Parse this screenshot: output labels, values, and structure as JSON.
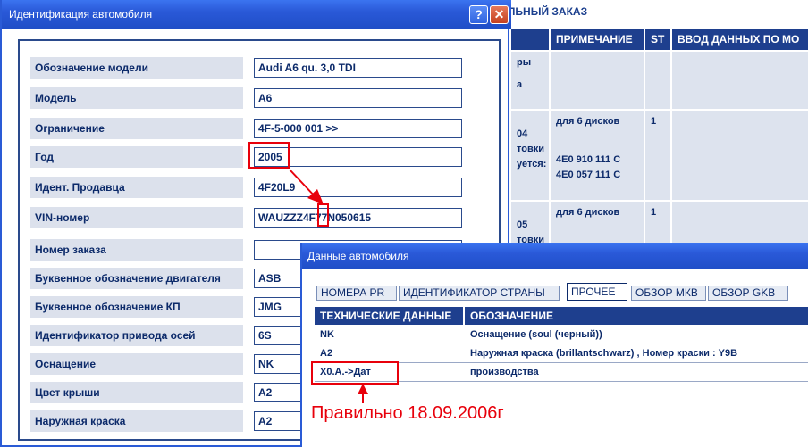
{
  "background": {
    "title": "ЛЬНЫЙ ЗАКАЗ",
    "headers": [
      "ПРИМЕЧАНИЕ",
      "ST",
      "ВВОД ДАННЫХ ПО МО"
    ],
    "left_fragments": {
      "r1": [
        "ры",
        "а"
      ],
      "r2": [
        "04",
        "товки",
        "уется:"
      ],
      "r3": [
        "05",
        "товки"
      ]
    },
    "rows": [
      {
        "note": "для 6 дисков",
        "st": "1",
        "parts": [
          "4E0 910 111 C",
          "4E0 057 111 C"
        ]
      },
      {
        "note": "для 6 дисков",
        "st": "1"
      }
    ]
  },
  "identification": {
    "title": "Идентификация автомобиля",
    "help_label": "?",
    "close_label": "✕",
    "fields": [
      {
        "label": "Обозначение модели",
        "value": "Audi A6 qu. 3,0 TDI"
      },
      {
        "label": "Модель",
        "value": "A6"
      },
      {
        "label": "Ограничение",
        "value": "4F-5-000 001 >>"
      },
      {
        "label": "Год",
        "value": "2005"
      },
      {
        "label": "Идент. Продавца",
        "value": "4F20L9"
      },
      {
        "label": "VIN-номер",
        "value": "WAUZZZ4F77N050615"
      },
      {
        "label": "Номер заказа",
        "value": ""
      },
      {
        "label": "Буквенное обозначение двигателя",
        "value": "ASB"
      },
      {
        "label": "Буквенное обозначение КП",
        "value": "JMG"
      },
      {
        "label": "Идентификатор привода осей",
        "value": "6S"
      },
      {
        "label": "Оснащение",
        "value": "NK"
      },
      {
        "label": "Цвет крыши",
        "value": "A2"
      },
      {
        "label": "Наружная краска",
        "value": "A2"
      }
    ]
  },
  "vehicle_data": {
    "title": "Данные автомобиля",
    "tabs": [
      "НОМЕРА PR",
      "ИДЕНТИФИКАТОР СТРАНЫ",
      "ПРОЧЕЕ",
      "ОБЗОР МКВ",
      "ОБЗОР GKB"
    ],
    "active_tab": "ПРОЧЕЕ",
    "columns": [
      "ТЕХНИЧЕСКИЕ ДАННЫЕ",
      "ОБОЗНАЧЕНИЕ"
    ],
    "rows": [
      {
        "tech": "NK",
        "desc": "Оснащение (soul (черный))"
      },
      {
        "tech": "A2",
        "desc": "Наружная краска (brillantschwarz) , Номер краски : Y9B"
      },
      {
        "tech": "X0.A.->Дат",
        "desc": "производства"
      }
    ]
  },
  "annotation": {
    "text": "Правильно 18.09.2006г",
    "color": "#e8000b"
  }
}
